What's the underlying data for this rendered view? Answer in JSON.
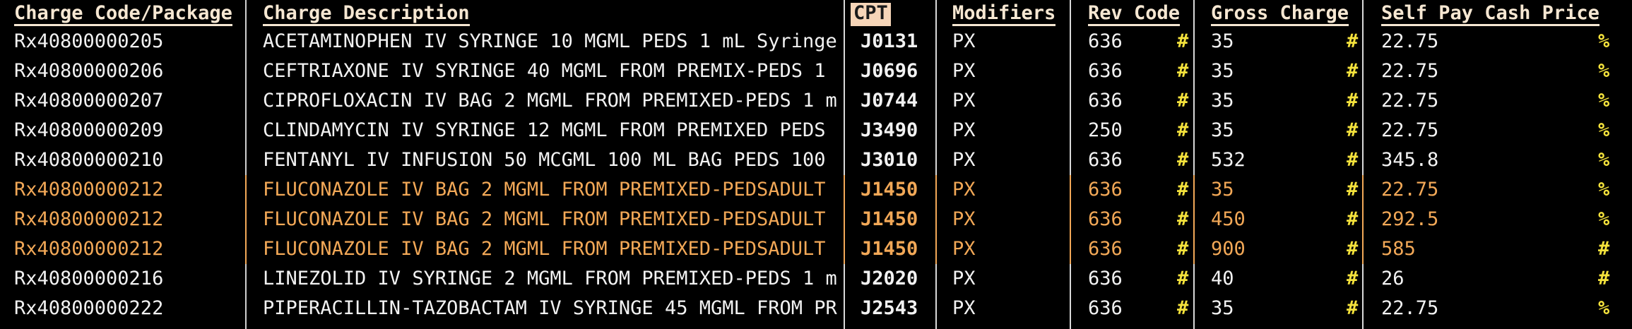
{
  "columns": {
    "charge_code": "Charge Code/Package",
    "description": "Charge Description",
    "cpt": "CPT",
    "modifiers": "Modifiers",
    "rev_code": "Rev Code",
    "gross_charge": "Gross Charge",
    "self_pay": "Self Pay Cash Price"
  },
  "colors": {
    "background": "#000000",
    "text": "#f2f2f2",
    "highlight_row": "#f2a857",
    "type_marker": "#f4e23c",
    "header_cpt_bg": "#f6d5b8"
  },
  "rows": [
    {
      "code": "Rx40800000205",
      "desc": "ACETAMINOPHEN IV SYRINGE 10 MGML PEDS 1 mL Syringe",
      "cpt": "J0131",
      "mod": "PX",
      "rev": "636",
      "rev_mark": "#",
      "gross": "35",
      "gross_mark": "#",
      "self": "22.75",
      "self_mark": "%",
      "highlight": false
    },
    {
      "code": "Rx40800000206",
      "desc": "CEFTRIAXONE IV SYRINGE 40 MGML FROM PREMIX-PEDS 1",
      "cpt": "J0696",
      "mod": "PX",
      "rev": "636",
      "rev_mark": "#",
      "gross": "35",
      "gross_mark": "#",
      "self": "22.75",
      "self_mark": "%",
      "highlight": false
    },
    {
      "code": "Rx40800000207",
      "desc": "CIPROFLOXACIN IV BAG 2 MGML FROM PREMIXED-PEDS 1 m",
      "cpt": "J0744",
      "mod": "PX",
      "rev": "636",
      "rev_mark": "#",
      "gross": "35",
      "gross_mark": "#",
      "self": "22.75",
      "self_mark": "%",
      "highlight": false
    },
    {
      "code": "Rx40800000209",
      "desc": "CLINDAMYCIN IV SYRINGE 12 MGML FROM PREMIXED PEDS",
      "cpt": "J3490",
      "mod": "PX",
      "rev": "250",
      "rev_mark": "#",
      "gross": "35",
      "gross_mark": "#",
      "self": "22.75",
      "self_mark": "%",
      "highlight": false
    },
    {
      "code": "Rx40800000210",
      "desc": "FENTANYL IV INFUSION 50 MCGML 100 ML BAG PEDS 100",
      "cpt": "J3010",
      "mod": "PX",
      "rev": "636",
      "rev_mark": "#",
      "gross": "532",
      "gross_mark": "#",
      "self": "345.8",
      "self_mark": "%",
      "highlight": false
    },
    {
      "code": "Rx40800000212",
      "desc": "FLUCONAZOLE IV BAG 2 MGML FROM PREMIXED-PEDSADULT",
      "cpt": "J1450",
      "mod": "PX",
      "rev": "636",
      "rev_mark": "#",
      "gross": "35",
      "gross_mark": "#",
      "self": "22.75",
      "self_mark": "%",
      "highlight": true
    },
    {
      "code": "Rx40800000212",
      "desc": "FLUCONAZOLE IV BAG 2 MGML FROM PREMIXED-PEDSADULT",
      "cpt": "J1450",
      "mod": "PX",
      "rev": "636",
      "rev_mark": "#",
      "gross": "450",
      "gross_mark": "#",
      "self": "292.5",
      "self_mark": "%",
      "highlight": true
    },
    {
      "code": "Rx40800000212",
      "desc": "FLUCONAZOLE IV BAG 2 MGML FROM PREMIXED-PEDSADULT",
      "cpt": "J1450",
      "mod": "PX",
      "rev": "636",
      "rev_mark": "#",
      "gross": "900",
      "gross_mark": "#",
      "self": "585",
      "self_mark": "#",
      "highlight": true
    },
    {
      "code": "Rx40800000216",
      "desc": "LINEZOLID IV SYRINGE 2 MGML FROM PREMIXED-PEDS 1 m",
      "cpt": "J2020",
      "mod": "PX",
      "rev": "636",
      "rev_mark": "#",
      "gross": "40",
      "gross_mark": "#",
      "self": "26",
      "self_mark": "#",
      "highlight": false
    },
    {
      "code": "Rx40800000222",
      "desc": "PIPERACILLIN-TAZOBACTAM IV SYRINGE 45 MGML FROM PR",
      "cpt": "J2543",
      "mod": "PX",
      "rev": "636",
      "rev_mark": "#",
      "gross": "35",
      "gross_mark": "#",
      "self": "22.75",
      "self_mark": "%",
      "highlight": false
    }
  ]
}
